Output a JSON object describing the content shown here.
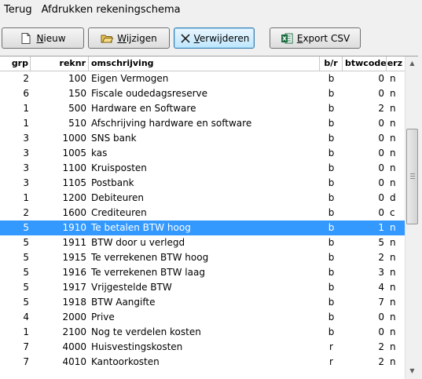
{
  "menu": [
    "Terug",
    "Afdrukken rekeningschema"
  ],
  "toolbar": {
    "nieuw": {
      "pre": "",
      "u": "N",
      "post": "ieuw",
      "icon": "new-document-icon"
    },
    "wijzigen": {
      "pre": "",
      "u": "W",
      "post": "ijzigen",
      "icon": "open-folder-icon"
    },
    "verwijderen": {
      "pre": "",
      "u": "V",
      "post": "erwijderen",
      "icon": "delete-x-icon"
    },
    "export": {
      "pre": "",
      "u": "E",
      "post": "xport CSV",
      "icon": "excel-icon"
    }
  },
  "columns": [
    "grp",
    "reknr",
    "omschrijving",
    "b/r",
    "btwcode",
    "verz"
  ],
  "selected_index": 10,
  "rows": [
    [
      "2",
      "100",
      "Eigen Vermogen",
      "b",
      "0",
      "n"
    ],
    [
      "6",
      "150",
      "Fiscale oudedagsreserve",
      "b",
      "0",
      "n"
    ],
    [
      "1",
      "500",
      "Hardware en Software",
      "b",
      "2",
      "n"
    ],
    [
      "1",
      "510",
      "Afschrijving hardware en software",
      "b",
      "0",
      "n"
    ],
    [
      "3",
      "1000",
      "SNS bank",
      "b",
      "0",
      "n"
    ],
    [
      "3",
      "1005",
      "kas",
      "b",
      "0",
      "n"
    ],
    [
      "3",
      "1100",
      "Kruisposten",
      "b",
      "0",
      "n"
    ],
    [
      "3",
      "1105",
      "Postbank",
      "b",
      "0",
      "n"
    ],
    [
      "1",
      "1200",
      "Debiteuren",
      "b",
      "0",
      "d"
    ],
    [
      "2",
      "1600",
      "Crediteuren",
      "b",
      "0",
      "c"
    ],
    [
      "5",
      "1910",
      "Te betalen BTW hoog",
      "b",
      "1",
      "n"
    ],
    [
      "5",
      "1911",
      "BTW door u verlegd",
      "b",
      "5",
      "n"
    ],
    [
      "5",
      "1915",
      "Te verrekenen BTW hoog",
      "b",
      "2",
      "n"
    ],
    [
      "5",
      "1916",
      "Te verrekenen BTW laag",
      "b",
      "3",
      "n"
    ],
    [
      "5",
      "1917",
      "Vrijgestelde BTW",
      "b",
      "4",
      "n"
    ],
    [
      "5",
      "1918",
      "BTW Aangifte",
      "b",
      "7",
      "n"
    ],
    [
      "4",
      "2000",
      "Prive",
      "b",
      "0",
      "n"
    ],
    [
      "1",
      "2100",
      "Nog te verdelen kosten",
      "b",
      "0",
      "n"
    ],
    [
      "7",
      "4000",
      "Huisvestingskosten",
      "r",
      "2",
      "n"
    ],
    [
      "7",
      "4010",
      "Kantoorkosten",
      "r",
      "2",
      "n"
    ]
  ],
  "scrollbar": {
    "up": "▲",
    "down": "▼"
  }
}
